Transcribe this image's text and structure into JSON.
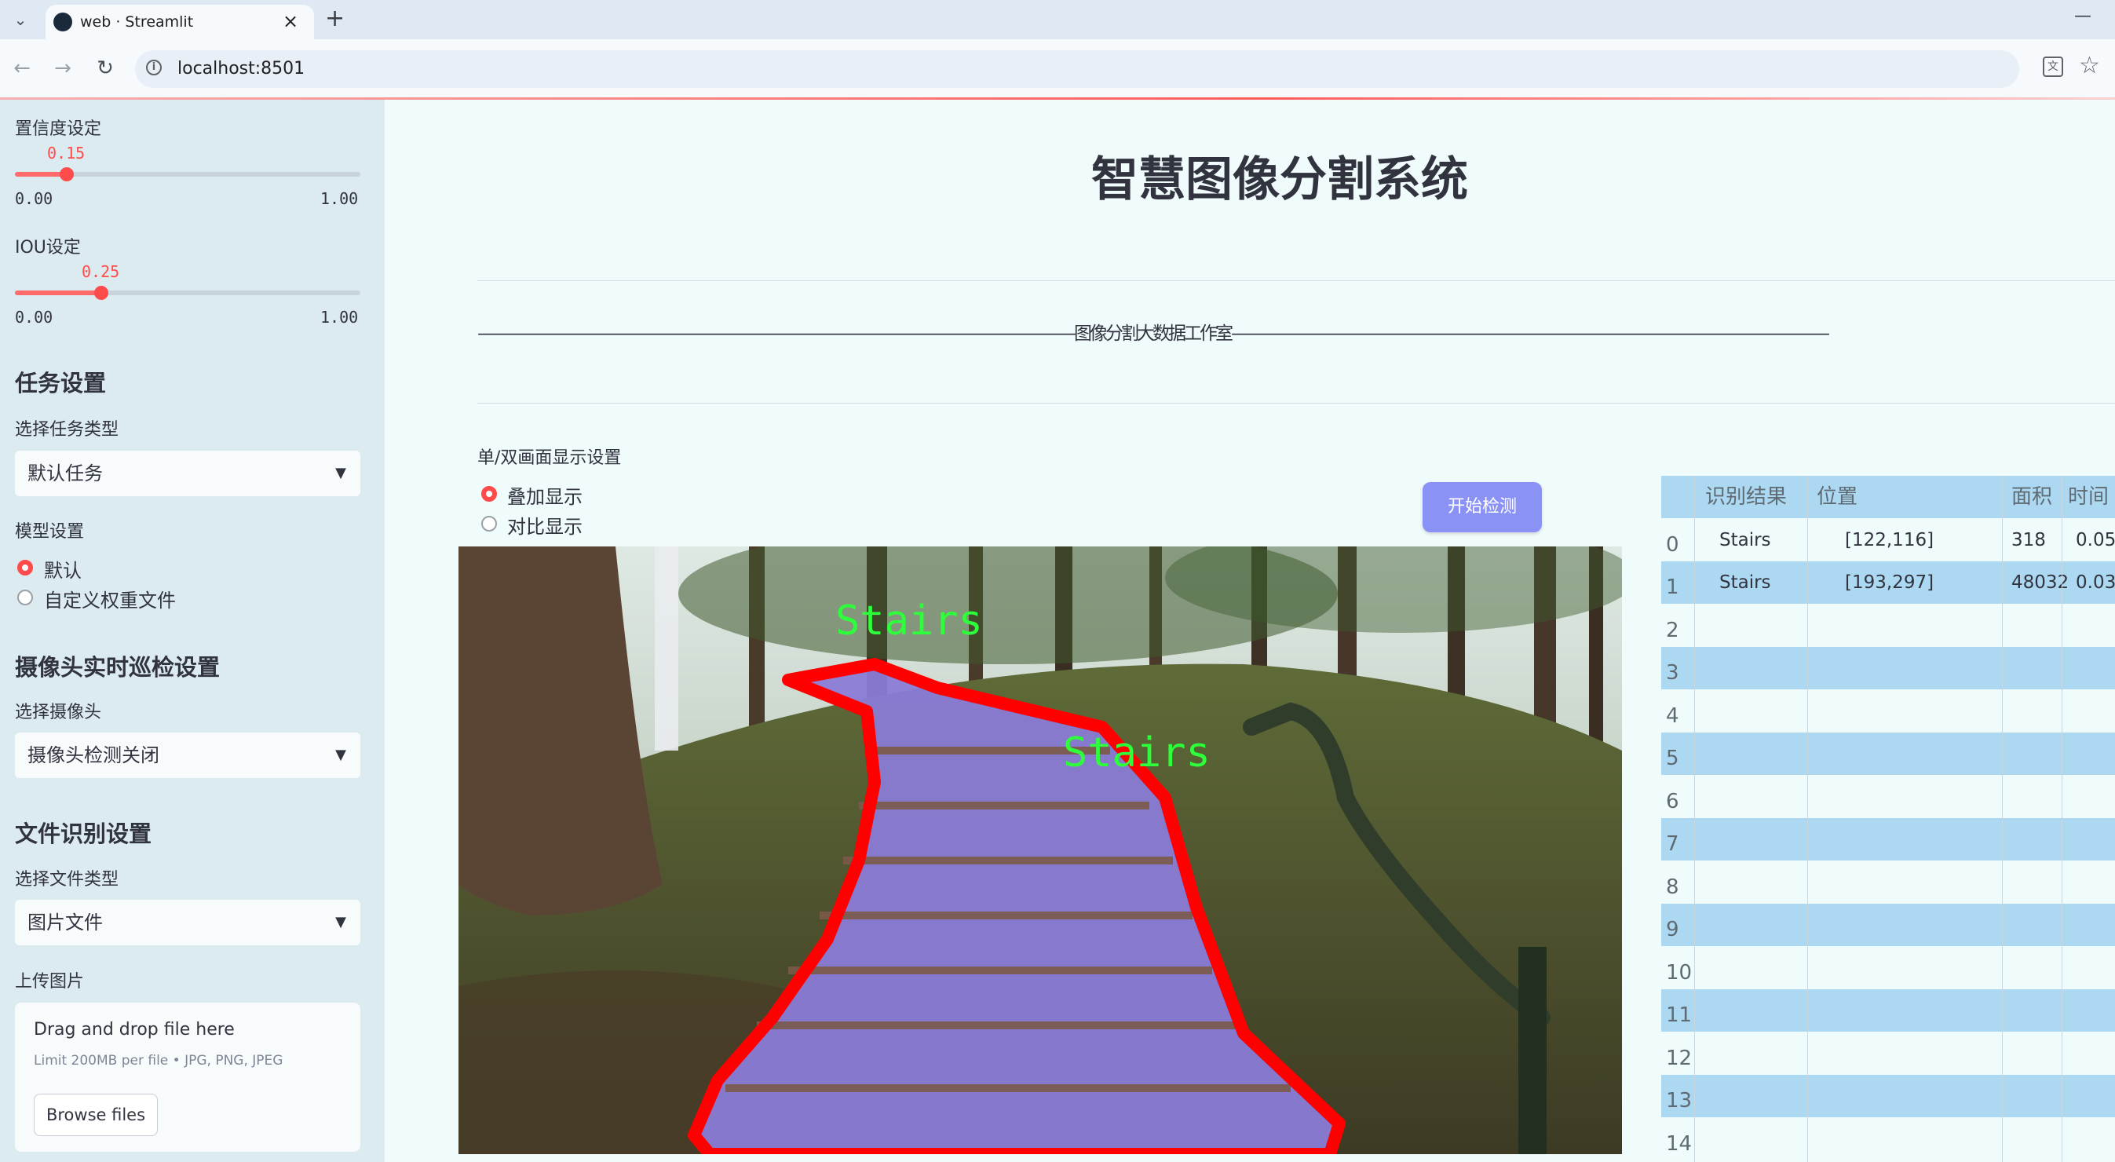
{
  "browser": {
    "tab_title": "web · Streamlit",
    "url": "localhost:8501",
    "new_tab": "+",
    "close_tab": "×",
    "minimize": "—"
  },
  "sidebar": {
    "confidence": {
      "label": "置信度设定",
      "value": "0.15",
      "min": "0.00",
      "max": "1.00",
      "level": 0.15
    },
    "iou": {
      "label": "IOU设定",
      "value": "0.25",
      "min": "0.00",
      "max": "1.00",
      "level": 0.25
    },
    "task": {
      "heading": "任务设置",
      "label": "选择任务类型",
      "selected": "默认任务"
    },
    "model": {
      "label": "模型设置",
      "options": [
        "默认",
        "自定义权重文件"
      ],
      "selected_index": 0
    },
    "camera": {
      "heading": "摄像头实时巡检设置",
      "label": "选择摄像头",
      "selected": "摄像头检测关闭"
    },
    "file": {
      "heading": "文件识别设置",
      "label": "选择文件类型",
      "selected": "图片文件"
    },
    "upload": {
      "label": "上传图片",
      "drop_text": "Drag and drop file here",
      "limit_text": "Limit 200MB per file • JPG, PNG, JPEG",
      "browse": "Browse files"
    }
  },
  "main": {
    "title": "智慧图像分割系统",
    "subtitle": "——————————————————————————————————————图像分割大数据工作室——————————————————————————————————————",
    "display_label": "单/双画面显示设置",
    "display_options": [
      "叠加显示",
      "对比显示"
    ],
    "display_selected": 0,
    "start_button": "开始检测",
    "detections": [
      {
        "label": "Stairs"
      },
      {
        "label": "Stairs"
      }
    ]
  },
  "table": {
    "columns": [
      "",
      "识别结果",
      "位置",
      "面积",
      "时间"
    ],
    "rows": [
      {
        "index": "0",
        "result": "Stairs",
        "position": "[122,116]",
        "area": "318",
        "time": "0.05"
      },
      {
        "index": "1",
        "result": "Stairs",
        "position": "[193,297]",
        "area": "48032",
        "time": "0.03"
      },
      {
        "index": "2",
        "result": "",
        "position": "",
        "area": "",
        "time": ""
      },
      {
        "index": "3",
        "result": "",
        "position": "",
        "area": "",
        "time": ""
      },
      {
        "index": "4",
        "result": "",
        "position": "",
        "area": "",
        "time": ""
      },
      {
        "index": "5",
        "result": "",
        "position": "",
        "area": "",
        "time": ""
      },
      {
        "index": "6",
        "result": "",
        "position": "",
        "area": "",
        "time": ""
      },
      {
        "index": "7",
        "result": "",
        "position": "",
        "area": "",
        "time": ""
      },
      {
        "index": "8",
        "result": "",
        "position": "",
        "area": "",
        "time": ""
      },
      {
        "index": "9",
        "result": "",
        "position": "",
        "area": "",
        "time": ""
      },
      {
        "index": "10",
        "result": "",
        "position": "",
        "area": "",
        "time": ""
      },
      {
        "index": "11",
        "result": "",
        "position": "",
        "area": "",
        "time": ""
      },
      {
        "index": "12",
        "result": "",
        "position": "",
        "area": "",
        "time": ""
      },
      {
        "index": "13",
        "result": "",
        "position": "",
        "area": "",
        "time": ""
      },
      {
        "index": "14",
        "result": "",
        "position": "",
        "area": "",
        "time": ""
      }
    ]
  },
  "colors": {
    "accent": "#ff4b4b",
    "button": "#8b92f6",
    "table_stripe": "#acd8f2",
    "mask_outline": "#ff0000",
    "mask_fill": "#8a7bd6",
    "label_text": "#2dff3a"
  }
}
